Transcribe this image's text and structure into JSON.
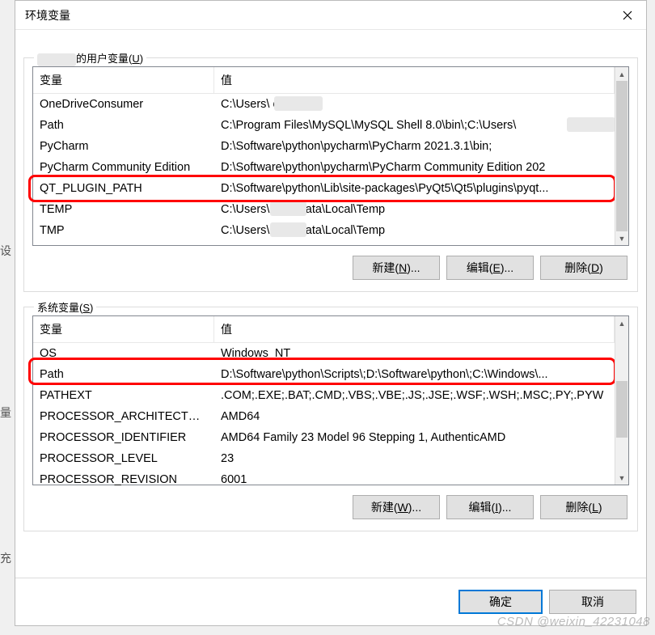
{
  "window": {
    "title": "环境变量"
  },
  "user_vars": {
    "legend_prefix_hidden": "    ",
    "legend_suffix": "的用户变量(",
    "legend_access": "U",
    "legend_close": ")",
    "col_variable": "变量",
    "col_value": "值",
    "rows": [
      {
        "name": "OneDriveConsumer",
        "value": "C:\\Users\\            eDrive"
      },
      {
        "name": "Path",
        "value": "C:\\Program Files\\MySQL\\MySQL Shell 8.0\\bin\\;C:\\Users\\"
      },
      {
        "name": "PyCharm",
        "value": "D:\\Software\\python\\pycharm\\PyCharm 2021.3.1\\bin;"
      },
      {
        "name": "PyCharm Community Edition",
        "value": "D:\\Software\\python\\pycharm\\PyCharm Community Edition 202"
      },
      {
        "name": "QT_PLUGIN_PATH",
        "value": "D:\\Software\\python\\Lib\\site-packages\\PyQt5\\Qt5\\plugins\\pyqt..."
      },
      {
        "name": "TEMP",
        "value": "C:\\Users\\          \\AppData\\Local\\Temp"
      },
      {
        "name": "TMP",
        "value": "C:\\Users\\          \\AppData\\Local\\Temp"
      }
    ],
    "btn_new": "新建(N)...",
    "btn_edit": "编辑(E)...",
    "btn_del": "删除(D)"
  },
  "system_vars": {
    "legend": "系统变量(",
    "legend_access": "S",
    "legend_close": ")",
    "col_variable": "变量",
    "col_value": "值",
    "rows": [
      {
        "name": "OS",
        "value": "Windows_NT"
      },
      {
        "name": "Path",
        "value": "D:\\Software\\python\\Scripts\\;D:\\Software\\python\\;C:\\Windows\\..."
      },
      {
        "name": "PATHEXT",
        "value": ".COM;.EXE;.BAT;.CMD;.VBS;.VBE;.JS;.JSE;.WSF;.WSH;.MSC;.PY;.PYW"
      },
      {
        "name": "PROCESSOR_ARCHITECTURE",
        "value": "AMD64"
      },
      {
        "name": "PROCESSOR_IDENTIFIER",
        "value": "AMD64 Family 23 Model 96 Stepping 1, AuthenticAMD"
      },
      {
        "name": "PROCESSOR_LEVEL",
        "value": "23"
      },
      {
        "name": "PROCESSOR_REVISION",
        "value": "6001"
      }
    ],
    "btn_new": "新建(W)...",
    "btn_edit": "编辑(I)...",
    "btn_del": "删除(L)"
  },
  "footer": {
    "ok": "确定",
    "cancel": "取消"
  },
  "watermark": "CSDN @weixin_42231048"
}
